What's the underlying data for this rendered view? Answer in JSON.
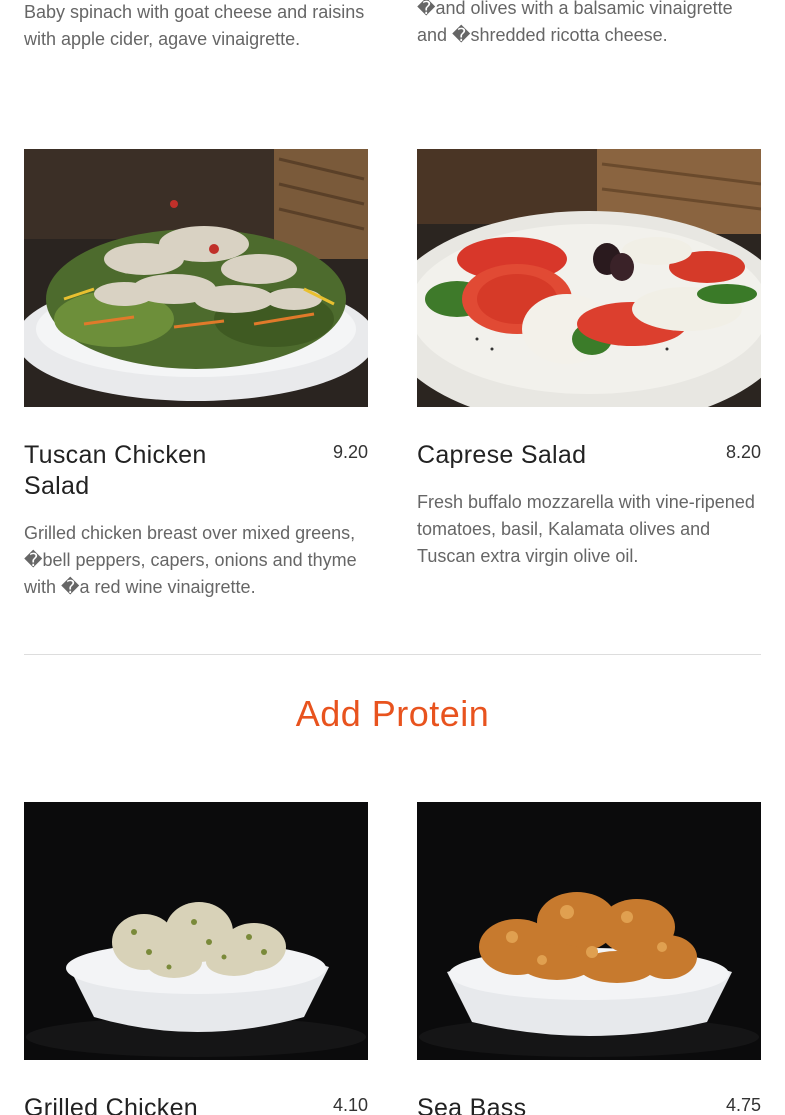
{
  "top_descriptions": {
    "left": "Baby spinach with goat cheese and raisins with apple cider, agave  vinaigrette.",
    "right": "�and olives with a balsamic vinaigrette and �shredded ricotta cheese."
  },
  "salads": [
    {
      "name": "Tuscan Chicken Salad",
      "price": "9.20",
      "description": "Grilled chicken breast over mixed greens, �bell peppers, capers, onions and thyme with �a red wine vinaigrette."
    },
    {
      "name": "Caprese Salad",
      "price": "8.20",
      "description": "Fresh buffalo mozzarella with vine-ripened tomatoes, basil, Kalamata olives and Tuscan extra virgin olive oil."
    }
  ],
  "section": {
    "title": "Add Protein",
    "accent_color": "#e8531e"
  },
  "proteins": [
    {
      "name": "Grilled Chicken",
      "price": "4.10"
    },
    {
      "name": "Sea Bass",
      "price": "4.75"
    }
  ]
}
